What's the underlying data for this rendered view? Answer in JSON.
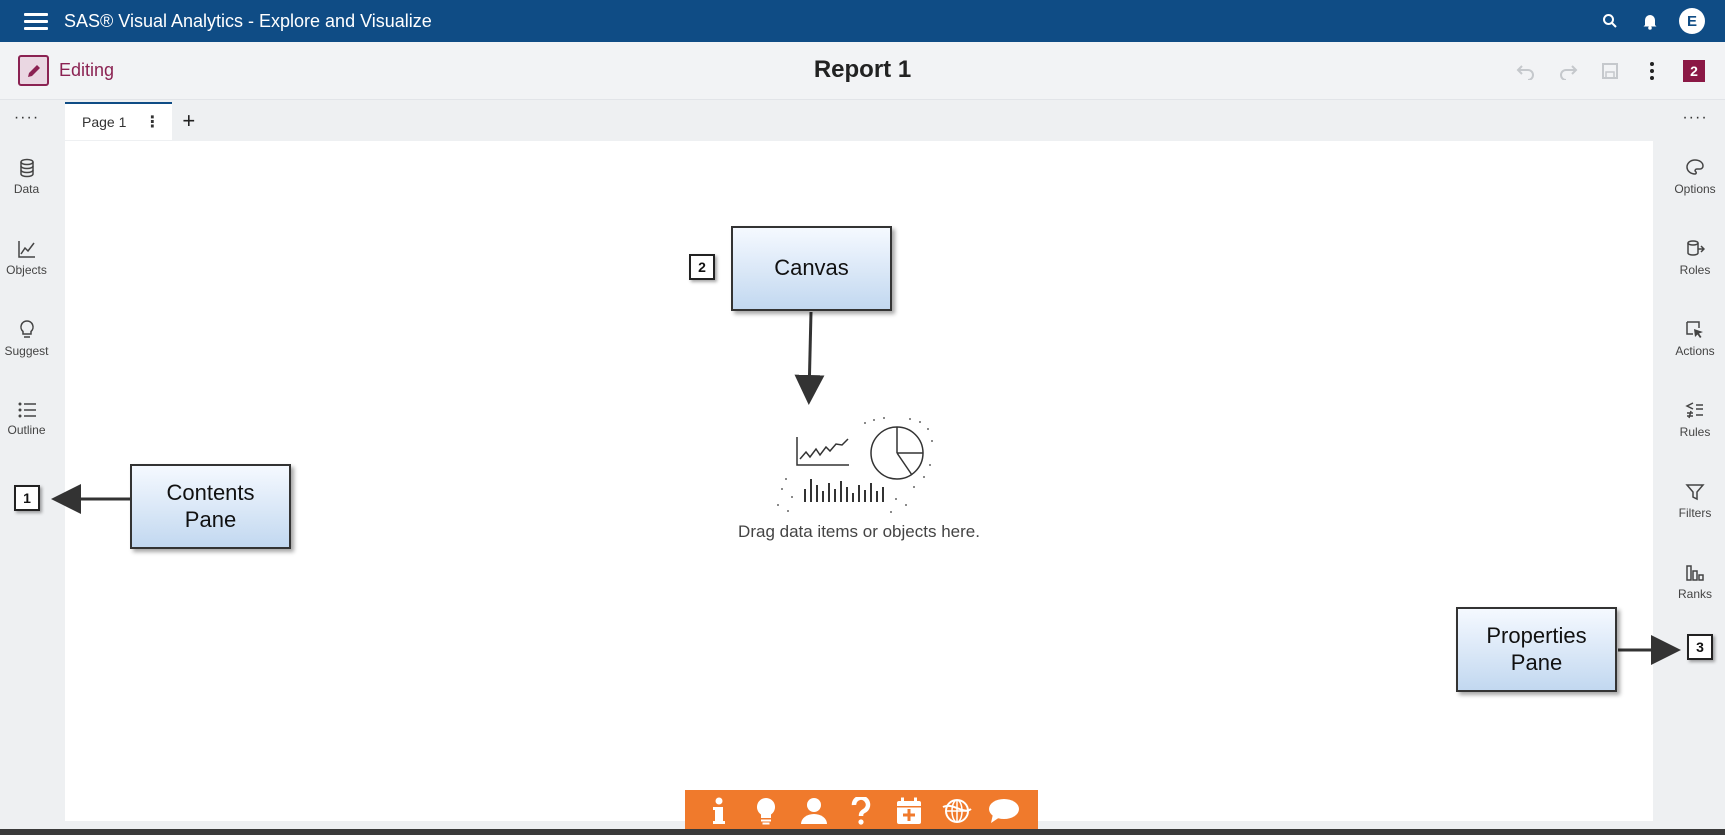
{
  "header": {
    "app_title": "SAS® Visual Analytics - Explore and Visualize",
    "avatar_initial": "E"
  },
  "editbar": {
    "mode_label": "Editing",
    "report_title": "Report 1",
    "badge_count": "2"
  },
  "left_pane": {
    "more": "····",
    "items": [
      {
        "label": "Data",
        "icon": "database-icon"
      },
      {
        "label": "Objects",
        "icon": "line-chart-icon"
      },
      {
        "label": "Suggest",
        "icon": "lightbulb-icon"
      },
      {
        "label": "Outline",
        "icon": "list-icon"
      }
    ]
  },
  "right_pane": {
    "more": "····",
    "items": [
      {
        "label": "Options",
        "icon": "palette-icon"
      },
      {
        "label": "Roles",
        "icon": "data-roles-icon"
      },
      {
        "label": "Actions",
        "icon": "cursor-icon"
      },
      {
        "label": "Rules",
        "icon": "rules-icon"
      },
      {
        "label": "Filters",
        "icon": "funnel-icon"
      },
      {
        "label": "Ranks",
        "icon": "ranks-icon"
      }
    ]
  },
  "tabs": [
    {
      "label": "Page 1"
    }
  ],
  "canvas": {
    "placeholder": "Drag data items or objects here."
  },
  "annotations": {
    "canvas": {
      "label": "Canvas",
      "number": "2"
    },
    "contents": {
      "label_line1": "Contents",
      "label_line2": "Pane",
      "number": "1"
    },
    "properties": {
      "label_line1": "Properties",
      "label_line2": "Pane",
      "number": "3"
    }
  },
  "bottom_toolbar": {
    "icons": [
      "info-icon",
      "lightbulb-icon",
      "user-icon",
      "help-icon",
      "calendar-add-icon",
      "globe-icon",
      "chat-icon"
    ]
  },
  "colors": {
    "header_bg": "#0f4c85",
    "accent": "#8b2252",
    "toolbar_orange": "#f07a2c"
  }
}
